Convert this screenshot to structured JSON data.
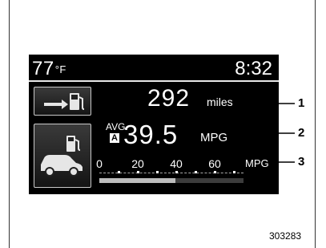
{
  "display": {
    "temperature": "77",
    "temperature_unit": "°F",
    "clock": "8:32",
    "range": {
      "value": "292",
      "unit": "miles",
      "icon": "car-arrow-fuel-pump-icon"
    },
    "avg_fuel_economy": {
      "label": "AVG.",
      "mode_badge": "A",
      "value": "39.5",
      "unit": "MPG",
      "icon": "car-fuel-pump-icon"
    },
    "scale": {
      "tick_labels": [
        "0",
        "20",
        "40",
        "60"
      ],
      "unit": "MPG",
      "max": 75,
      "current_fill_value": 39.5
    }
  },
  "callouts": [
    "1",
    "2",
    "3"
  ],
  "figure_code": "303283",
  "colors": {
    "screen_background": "#000000",
    "text": "#ffffff",
    "bar_fill": "#bdbdbd"
  }
}
